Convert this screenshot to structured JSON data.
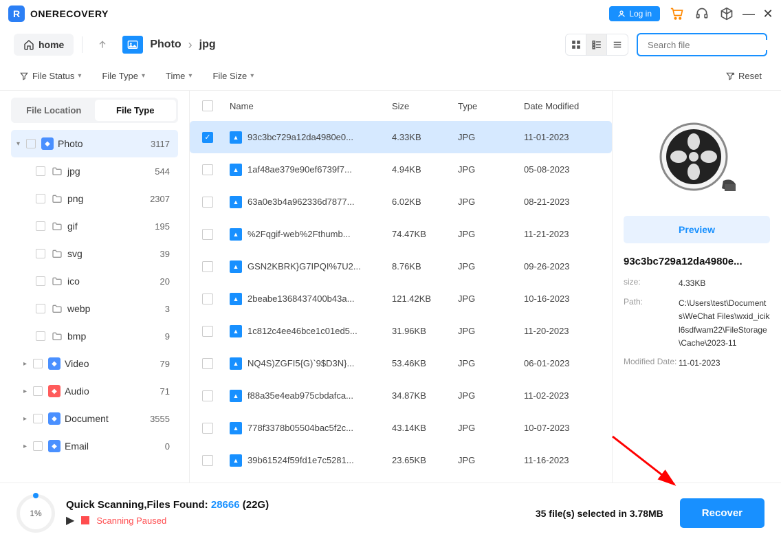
{
  "app": {
    "name": "ONERECOVERY",
    "login": "Log in"
  },
  "toolbar": {
    "home": "home"
  },
  "breadcrumb": {
    "root": "Photo",
    "current": "jpg"
  },
  "search": {
    "placeholder": "Search file"
  },
  "filters": {
    "status": "File Status",
    "type": "File Type",
    "time": "Time",
    "size": "File Size",
    "reset": "Reset"
  },
  "sidebar": {
    "tabs": {
      "location": "File Location",
      "type": "File Type"
    },
    "items": [
      {
        "label": "Photo",
        "count": "3117",
        "icon": "blue",
        "root": true
      },
      {
        "label": "jpg",
        "count": "544",
        "child": true,
        "folder": true
      },
      {
        "label": "png",
        "count": "2307",
        "child": true,
        "folder": true
      },
      {
        "label": "gif",
        "count": "195",
        "child": true,
        "folder": true
      },
      {
        "label": "svg",
        "count": "39",
        "child": true,
        "folder": true
      },
      {
        "label": "ico",
        "count": "20",
        "child": true,
        "folder": true
      },
      {
        "label": "webp",
        "count": "3",
        "child": true,
        "folder": true
      },
      {
        "label": "bmp",
        "count": "9",
        "child": true,
        "folder": true
      },
      {
        "label": "Video",
        "count": "79",
        "icon": "blue",
        "sub": true,
        "caret": true
      },
      {
        "label": "Audio",
        "count": "71",
        "icon": "red",
        "sub": true,
        "caret": true
      },
      {
        "label": "Document",
        "count": "3555",
        "icon": "blue",
        "sub": true,
        "caret": true
      },
      {
        "label": "Email",
        "count": "0",
        "icon": "blue",
        "sub": true,
        "caret": true
      }
    ]
  },
  "columns": {
    "name": "Name",
    "size": "Size",
    "type": "Type",
    "date": "Date Modified"
  },
  "files": [
    {
      "name": "93c3bc729a12da4980e0...",
      "size": "4.33KB",
      "type": "JPG",
      "date": "11-01-2023",
      "selected": true
    },
    {
      "name": "1af48ae379e90ef6739f7...",
      "size": "4.94KB",
      "type": "JPG",
      "date": "05-08-2023"
    },
    {
      "name": "63a0e3b4a962336d7877...",
      "size": "6.02KB",
      "type": "JPG",
      "date": "08-21-2023"
    },
    {
      "name": "%2Fqgif-web%2Fthumb...",
      "size": "74.47KB",
      "type": "JPG",
      "date": "11-21-2023"
    },
    {
      "name": "GSN2KBRK}G7IPQI%7U2...",
      "size": "8.76KB",
      "type": "JPG",
      "date": "09-26-2023"
    },
    {
      "name": "2beabe1368437400b43a...",
      "size": "121.42KB",
      "type": "JPG",
      "date": "10-16-2023"
    },
    {
      "name": "1c812c4ee46bce1c01ed5...",
      "size": "31.96KB",
      "type": "JPG",
      "date": "11-20-2023"
    },
    {
      "name": "NQ4S)ZGFI5{G)`9$D3N}...",
      "size": "53.46KB",
      "type": "JPG",
      "date": "06-01-2023"
    },
    {
      "name": "f88a35e4eab975cbdafca...",
      "size": "34.87KB",
      "type": "JPG",
      "date": "11-02-2023"
    },
    {
      "name": "778f3378b05504bac5f2c...",
      "size": "43.14KB",
      "type": "JPG",
      "date": "10-07-2023"
    },
    {
      "name": "39b61524f59fd1e7c5281...",
      "size": "23.65KB",
      "type": "JPG",
      "date": "11-16-2023"
    }
  ],
  "preview": {
    "button": "Preview",
    "filename": "93c3bc729a12da4980e...",
    "size_label": "size:",
    "size": "4.33KB",
    "path_label": "Path:",
    "path": "C:\\Users\\test\\Documents\\WeChat Files\\wxid_icikl6sdfwam22\\FileStorage\\Cache\\2023-11",
    "date_label": "Modified Date:",
    "date": "11-01-2023"
  },
  "bottom": {
    "progress": "1%",
    "scan_label": "Quick Scanning,Files Found:",
    "count": "28666",
    "total_size": "(22G)",
    "status": "Scanning Paused",
    "selection": "35 file(s) selected in 3.78MB",
    "recover": "Recover"
  }
}
